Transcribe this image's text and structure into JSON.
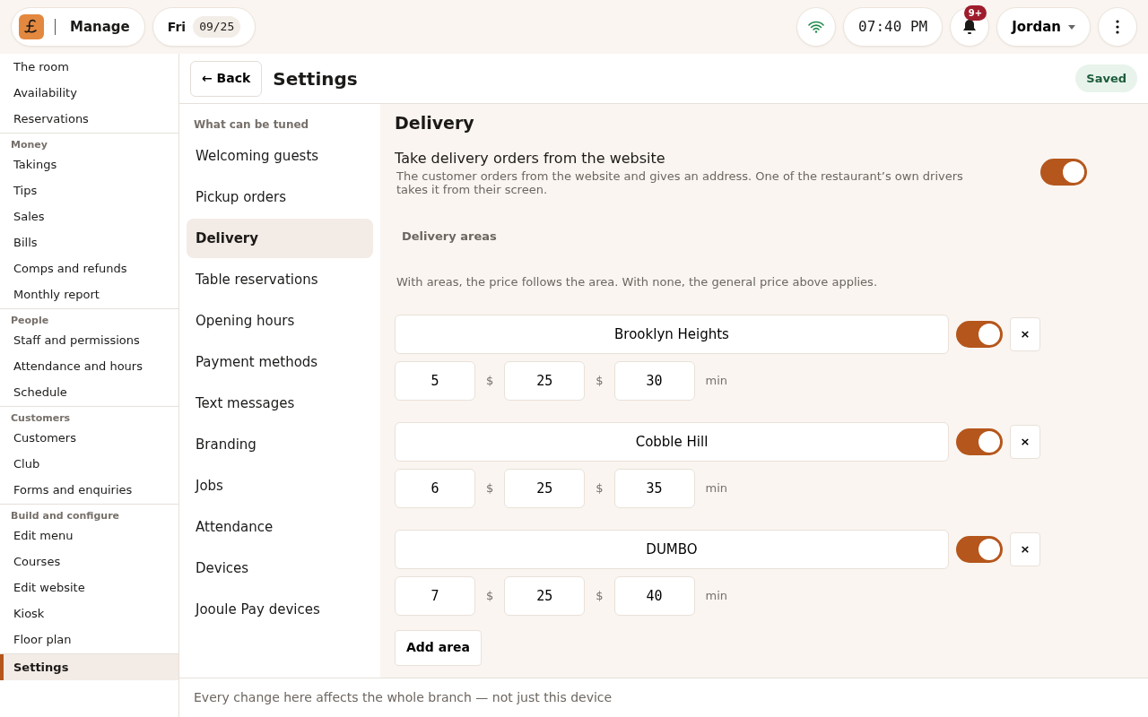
{
  "topbar": {
    "app_label": "Manage",
    "day": "Fri",
    "date": "09/25",
    "time": "07:40 PM",
    "notification_badge": "9+",
    "user": "Jordan"
  },
  "sidebar": {
    "groups": [
      {
        "items": [
          {
            "label": "The room",
            "selected": false
          },
          {
            "label": "Availability",
            "selected": false
          },
          {
            "label": "Reservations",
            "selected": false
          }
        ]
      },
      {
        "heading": "Money",
        "items": [
          {
            "label": "Takings",
            "selected": false
          },
          {
            "label": "Tips",
            "selected": false
          },
          {
            "label": "Sales",
            "selected": false
          },
          {
            "label": "Bills",
            "selected": false
          },
          {
            "label": "Comps and refunds",
            "selected": false
          },
          {
            "label": "Monthly report",
            "selected": false
          }
        ]
      },
      {
        "heading": "People",
        "items": [
          {
            "label": "Staff and permissions",
            "selected": false
          },
          {
            "label": "Attendance and hours",
            "selected": false
          },
          {
            "label": "Schedule",
            "selected": false
          }
        ]
      },
      {
        "heading": "Customers",
        "items": [
          {
            "label": "Customers",
            "selected": false
          },
          {
            "label": "Club",
            "selected": false
          },
          {
            "label": "Forms and enquiries",
            "selected": false
          }
        ]
      },
      {
        "heading": "Build and configure",
        "items": [
          {
            "label": "Edit menu",
            "selected": false
          },
          {
            "label": "Courses",
            "selected": false
          },
          {
            "label": "Edit website",
            "selected": false
          },
          {
            "label": "Kiosk",
            "selected": false
          },
          {
            "label": "Floor plan",
            "selected": false
          }
        ]
      },
      {
        "items": [
          {
            "label": "Settings",
            "selected": true
          }
        ]
      }
    ]
  },
  "header": {
    "back": "← Back",
    "title": "Settings",
    "status": "Saved"
  },
  "settings_nav": {
    "heading": "What can be tuned",
    "items": [
      {
        "label": "Welcoming guests",
        "selected": false
      },
      {
        "label": "Pickup orders",
        "selected": false
      },
      {
        "label": "Delivery",
        "selected": true
      },
      {
        "label": "Table reservations",
        "selected": false
      },
      {
        "label": "Opening hours",
        "selected": false
      },
      {
        "label": "Payment methods",
        "selected": false
      },
      {
        "label": "Text messages",
        "selected": false
      },
      {
        "label": "Branding",
        "selected": false
      },
      {
        "label": "Jobs",
        "selected": false
      },
      {
        "label": "Attendance",
        "selected": false
      },
      {
        "label": "Devices",
        "selected": false
      },
      {
        "label": "Jooule Pay devices",
        "selected": false
      }
    ]
  },
  "content": {
    "title": "Delivery",
    "setting": {
      "label": "Take delivery orders from the website",
      "description": "The customer orders from the website and gives an address. One of the restaurant’s own drivers takes it from their screen.",
      "on": true
    },
    "areas_heading": "Delivery areas",
    "areas_note": "With areas, the price follows the area. With none, the general price above applies.",
    "areas": [
      {
        "name": "Brooklyn Heights",
        "on": true,
        "remove": "×",
        "fields": [
          {
            "value": "5",
            "unit": "$"
          },
          {
            "value": "25",
            "unit": "$"
          },
          {
            "value": "30",
            "unit": "min"
          }
        ]
      },
      {
        "name": "Cobble Hill",
        "on": true,
        "remove": "×",
        "fields": [
          {
            "value": "6",
            "unit": "$"
          },
          {
            "value": "25",
            "unit": "$"
          },
          {
            "value": "35",
            "unit": "min"
          }
        ]
      },
      {
        "name": "DUMBO",
        "on": true,
        "remove": "×",
        "fields": [
          {
            "value": "7",
            "unit": "$"
          },
          {
            "value": "25",
            "unit": "$"
          },
          {
            "value": "40",
            "unit": "min"
          }
        ]
      }
    ],
    "add_button": "Add area"
  },
  "footer": "Every change here affects the whole branch — not just this device"
}
